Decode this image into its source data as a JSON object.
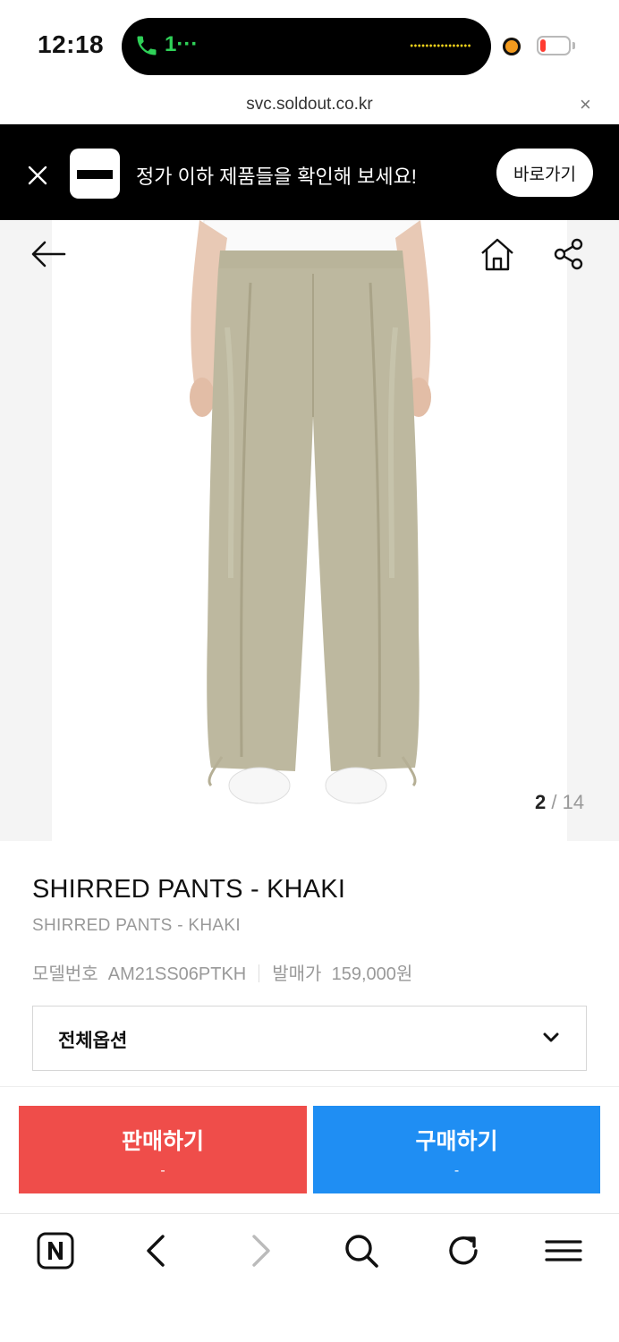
{
  "status_bar": {
    "time": "12:18",
    "call_text": "1···",
    "battery_level": 0.2
  },
  "browser": {
    "url": "svc.soldout.co.kr",
    "close_symbol": "×"
  },
  "banner": {
    "text": "정가 이하 제품들을 확인해 보세요!",
    "button_label": "바로가기"
  },
  "gallery": {
    "current": "2",
    "separator": " / ",
    "total": "14"
  },
  "product": {
    "title": "SHIRRED PANTS - KHAKI",
    "subtitle": "SHIRRED PANTS - KHAKI",
    "model_label": "모델번호",
    "model_value": "AM21SS06PTKH",
    "price_label": "발매가",
    "price_value": "159,000원",
    "option_label": "전체옵션"
  },
  "actions": {
    "sell_label": "판매하기",
    "sell_price": "-",
    "buy_label": "구매하기",
    "buy_price": "-"
  },
  "colors": {
    "sell": "#ef4d4a",
    "buy": "#1f8ef3",
    "banner_bg": "#000000",
    "product_khaki": "#bdb89f"
  },
  "toolbar": {
    "icons": [
      "naver-home-icon",
      "back-icon",
      "forward-icon",
      "search-icon",
      "refresh-icon",
      "menu-icon"
    ]
  }
}
